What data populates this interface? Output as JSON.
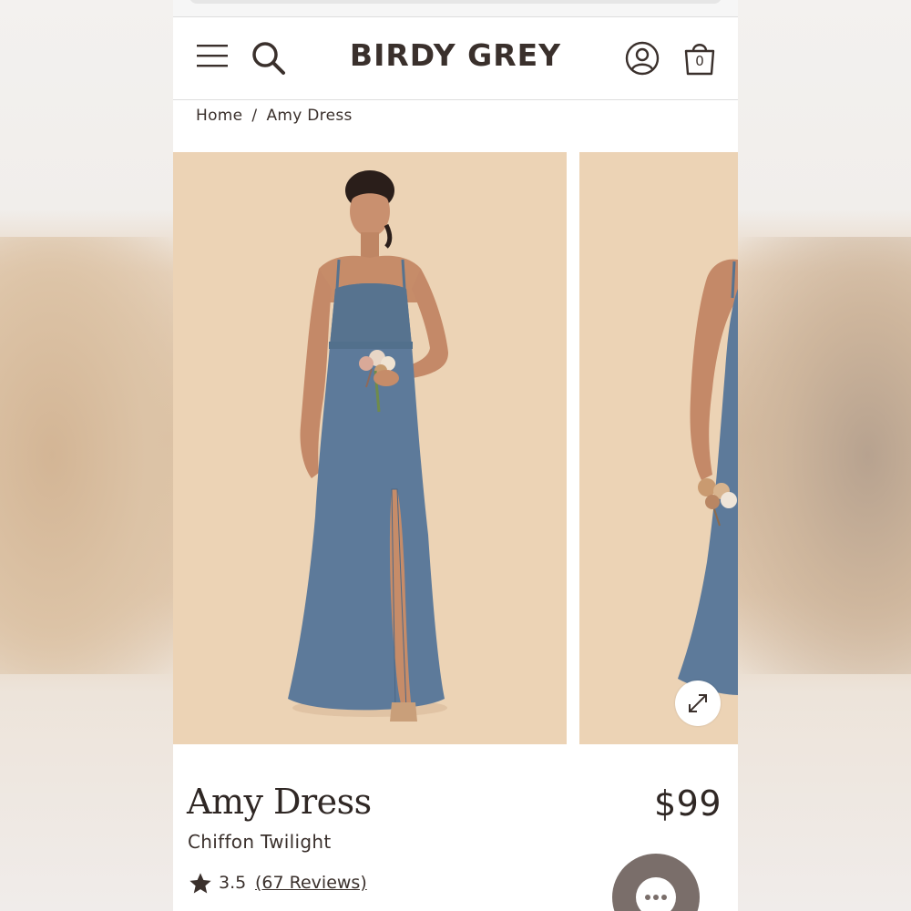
{
  "header": {
    "brand": "BIRDY GREY",
    "cart_count": "0",
    "icons": [
      "menu-icon",
      "search-icon",
      "account-icon",
      "shopping-bag-icon"
    ]
  },
  "breadcrumb": {
    "home": "Home",
    "separator": "/",
    "current": "Amy Dress"
  },
  "gallery": {
    "images": [
      "product-photo-front",
      "product-photo-side"
    ],
    "expand_icon": "expand-icon"
  },
  "product": {
    "name": "Amy Dress",
    "variant": "Chiffon Twilight",
    "price": "$99",
    "rating": "3.5",
    "reviews": "(67 Reviews)"
  },
  "colors": {
    "brand_text": "#3a302c",
    "photo_background": "#ecd3b5",
    "dress": "#5d7a9a",
    "chat_button": "#7a6e6a"
  }
}
